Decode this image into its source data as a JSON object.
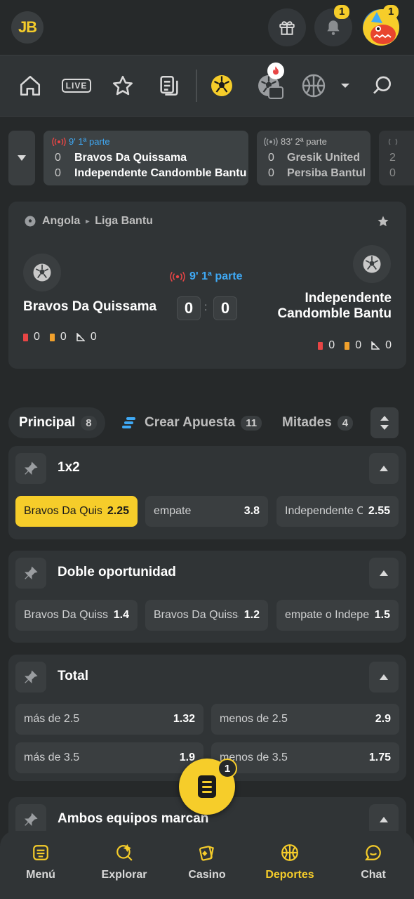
{
  "header": {
    "logo_text": "JB",
    "notifications_count": "1",
    "avatar_count": "1"
  },
  "nav": {
    "live_label": "LIVE",
    "items": [
      "home-icon",
      "live-icon",
      "star-icon",
      "betslip-history-icon",
      "football-icon",
      "football-hot-icon",
      "basketball-icon",
      "search-icon"
    ]
  },
  "live_strip": [
    {
      "time": "9' 1ª parte",
      "home_score": "0",
      "home": "Bravos Da Quissama",
      "away_score": "0",
      "away": "Independente Candomble Bantu"
    },
    {
      "time": "83' 2ª parte",
      "home_score": "0",
      "home": "Gresik United",
      "away_score": "0",
      "away": "Persiba Bantul"
    },
    {
      "home_score": "2",
      "away_score": "0"
    }
  ],
  "match": {
    "country": "Angola",
    "league": "Liga Bantu",
    "time": "9' 1ª parte",
    "home": "Bravos Da Quissama",
    "away_line1": "Independente",
    "away_line2": "Candomble Bantu",
    "home_score": "0",
    "away_score": "0",
    "separator": ":",
    "home_stats": {
      "red": "0",
      "yellow": "0",
      "corners": "0"
    },
    "away_stats": {
      "red": "0",
      "yellow": "0",
      "corners": "0"
    }
  },
  "tabs": [
    {
      "label": "Principal",
      "count": "8"
    },
    {
      "label": "Crear Apuesta",
      "count": "11"
    },
    {
      "label": "Mitades",
      "count": "4"
    }
  ],
  "markets": [
    {
      "title": "1x2",
      "odds": [
        {
          "label": "Bravos Da Quissama",
          "value": "2.25"
        },
        {
          "label": "empate",
          "value": "3.8"
        },
        {
          "label": "Independente Candomble Bantu",
          "value": "2.55"
        }
      ]
    },
    {
      "title": "Doble oportunidad",
      "odds": [
        {
          "label": "Bravos Da Quissama o empate",
          "value": "1.4"
        },
        {
          "label": "Bravos Da Quissama o Independente",
          "value": "1.2"
        },
        {
          "label": "empate o Independente",
          "value": "1.5"
        }
      ]
    },
    {
      "title": "Total",
      "odds": [
        {
          "label": "más de 2.5",
          "value": "1.32"
        },
        {
          "label": "menos de 2.5",
          "value": "2.9"
        },
        {
          "label": "más de 3.5",
          "value": "1.9"
        },
        {
          "label": "menos de 3.5",
          "value": "1.75"
        }
      ]
    },
    {
      "title": "Ambos equipos marcan"
    }
  ],
  "betslip": {
    "count": "1"
  },
  "bottom_nav": [
    {
      "label": "Menú"
    },
    {
      "label": "Explorar"
    },
    {
      "label": "Casino"
    },
    {
      "label": "Deportes"
    },
    {
      "label": "Chat"
    }
  ],
  "colors": {
    "accent": "#f6cd2a",
    "live_blue": "#3fa9f5",
    "live_red": "#e84545",
    "background": "#26292a",
    "card": "#303436"
  }
}
